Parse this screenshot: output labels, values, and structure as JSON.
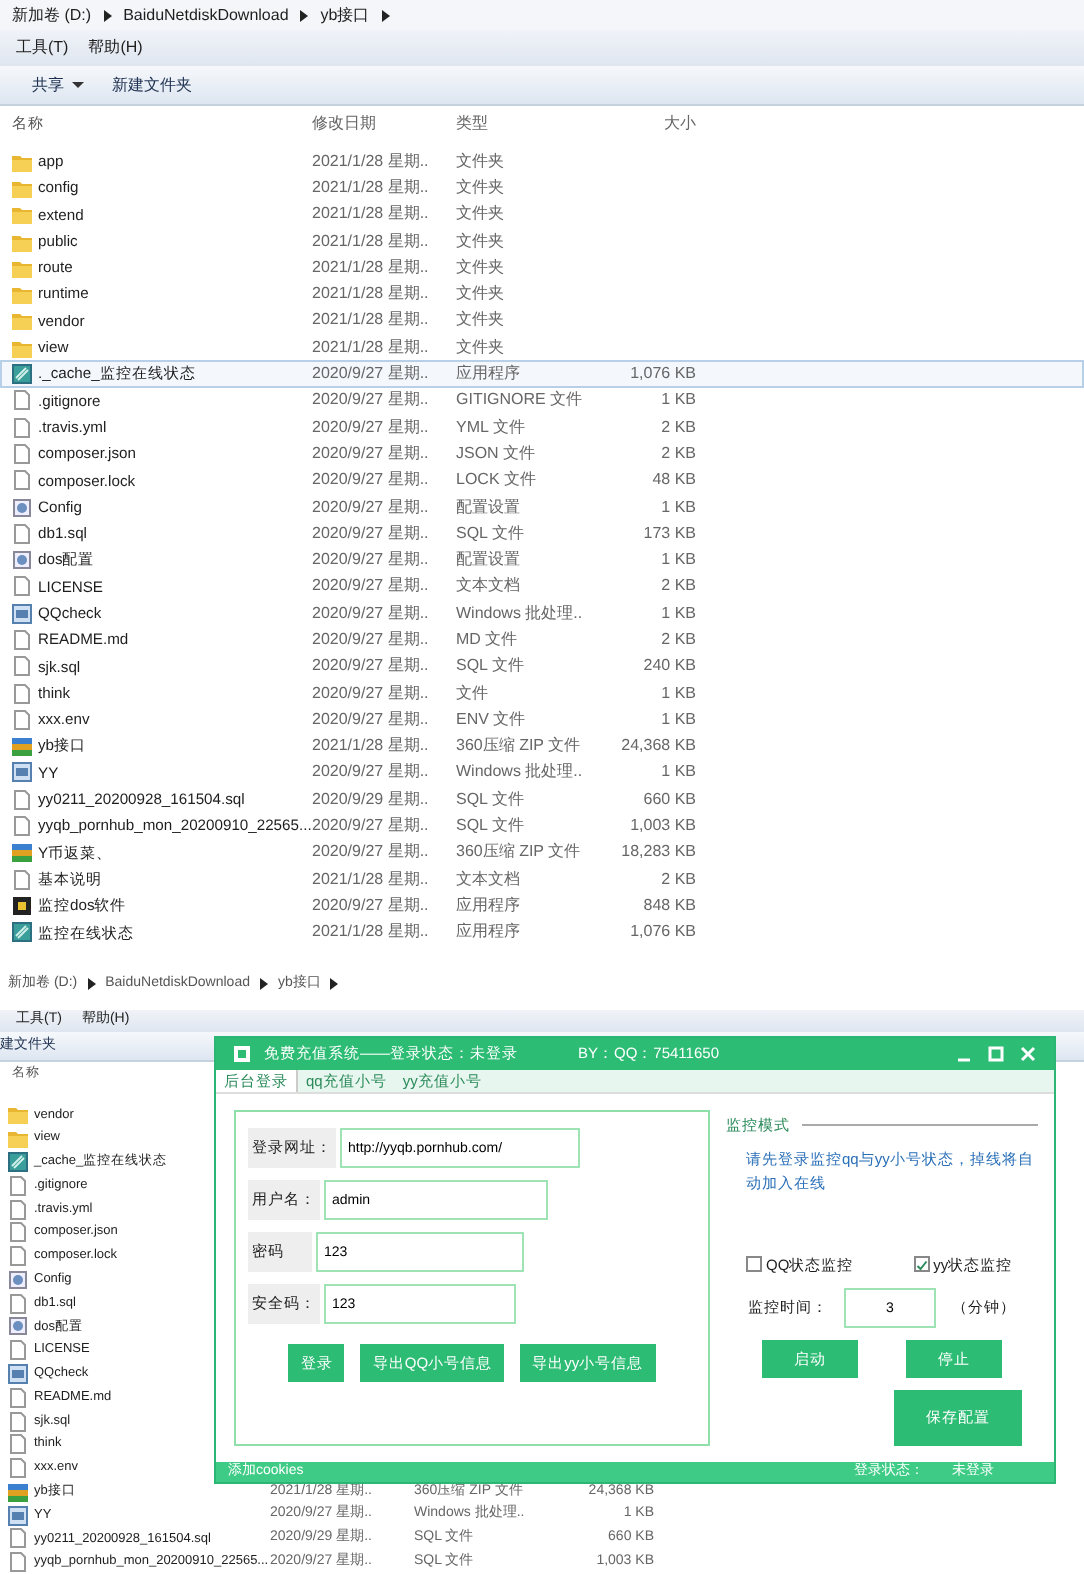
{
  "explorer": {
    "breadcrumb": [
      "新加卷 (D:)",
      "BaiduNetdiskDownload",
      "yb接口"
    ],
    "menu": [
      "工具(T)",
      "帮助(H)"
    ],
    "toolbar": [
      {
        "label": "共享",
        "kind": "dropdown"
      },
      {
        "label": "新建文件夹",
        "kind": "plain"
      }
    ],
    "columns": [
      "名称",
      "修改日期",
      "类型",
      "大小"
    ],
    "files": [
      {
        "name": "app",
        "date": "2021/1/28 星期..",
        "type": "文件夹",
        "kind": "folder",
        "selected": false
      },
      {
        "name": "config",
        "date": "2021/1/28 星期..",
        "type": "文件夹",
        "kind": "folder",
        "selected": false
      },
      {
        "name": "extend",
        "date": "2021/1/28 星期..",
        "type": "文件夹",
        "kind": "folder",
        "selected": false
      },
      {
        "name": "public",
        "date": "2021/1/28 星期..",
        "type": "文件夹",
        "kind": "folder",
        "selected": false
      },
      {
        "name": "route",
        "date": "2021/1/28 星期..",
        "type": "文件夹",
        "kind": "folder",
        "selected": false
      },
      {
        "name": "runtime",
        "date": "2021/1/28 星期..",
        "type": "文件夹",
        "kind": "folder",
        "selected": false
      },
      {
        "name": "vendor",
        "date": "2021/1/28 星期..",
        "type": "文件夹",
        "kind": "folder",
        "selected": false
      },
      {
        "name": "view",
        "date": "2021/1/28 星期..",
        "type": "文件夹",
        "kind": "folder",
        "selected": false
      },
      {
        "name": "._cache_监控在线状态",
        "date": "2020/9/27 星期..",
        "type": "应用程序",
        "size": "1,076 KB",
        "kind": "app",
        "selected": true
      },
      {
        "name": ".gitignore",
        "date": "2020/9/27 星期..",
        "type": "GITIGNORE 文件",
        "size": "1 KB",
        "kind": "file",
        "selected": false
      },
      {
        "name": ".travis.yml",
        "date": "2020/9/27 星期..",
        "type": "YML 文件",
        "size": "2 KB",
        "kind": "file",
        "selected": false
      },
      {
        "name": "composer.json",
        "date": "2020/9/27 星期..",
        "type": "JSON 文件",
        "size": "2 KB",
        "kind": "file",
        "selected": false
      },
      {
        "name": "composer.lock",
        "date": "2020/9/27 星期..",
        "type": "LOCK 文件",
        "size": "48 KB",
        "kind": "file",
        "selected": false
      },
      {
        "name": "Config",
        "date": "2020/9/27 星期..",
        "type": "配置设置",
        "size": "1 KB",
        "kind": "config",
        "selected": false
      },
      {
        "name": "db1.sql",
        "date": "2020/9/27 星期..",
        "type": "SQL 文件",
        "size": "173 KB",
        "kind": "file",
        "selected": false
      },
      {
        "name": "dos配置",
        "date": "2020/9/27 星期..",
        "type": "配置设置",
        "size": "1 KB",
        "kind": "config",
        "selected": false
      },
      {
        "name": "LICENSE",
        "date": "2020/9/27 星期..",
        "type": "文本文档",
        "size": "2 KB",
        "kind": "file",
        "selected": false
      },
      {
        "name": "QQcheck",
        "date": "2020/9/27 星期..",
        "type": "Windows 批处理..",
        "size": "1 KB",
        "kind": "batch",
        "selected": false
      },
      {
        "name": "README.md",
        "date": "2020/9/27 星期..",
        "type": "MD 文件",
        "size": "2 KB",
        "kind": "file",
        "selected": false
      },
      {
        "name": "sjk.sql",
        "date": "2020/9/27 星期..",
        "type": "SQL 文件",
        "size": "240 KB",
        "kind": "file",
        "selected": false
      },
      {
        "name": "think",
        "date": "2020/9/27 星期..",
        "type": "文件",
        "size": "1 KB",
        "kind": "file",
        "selected": false
      },
      {
        "name": "xxx.env",
        "date": "2020/9/27 星期..",
        "type": "ENV 文件",
        "size": "1 KB",
        "kind": "file",
        "selected": false
      },
      {
        "name": "yb接口",
        "date": "2021/1/28 星期..",
        "type": "360压缩 ZIP 文件",
        "size": "24,368 KB",
        "kind": "zip",
        "selected": false
      },
      {
        "name": "YY",
        "date": "2020/9/27 星期..",
        "type": "Windows 批处理..",
        "size": "1 KB",
        "kind": "batch",
        "selected": false
      },
      {
        "name": "yy0211_20200928_161504.sql",
        "date": "2020/9/29 星期..",
        "type": "SQL 文件",
        "size": "660 KB",
        "kind": "file",
        "selected": false
      },
      {
        "name": "yyqb_pornhub_mon_20200910_22565...",
        "date": "2020/9/27 星期..",
        "type": "SQL 文件",
        "size": "1,003 KB",
        "kind": "file",
        "selected": false
      },
      {
        "name": "Y币返菜、",
        "date": "2020/9/27 星期..",
        "type": "360压缩 ZIP 文件",
        "size": "18,283 KB",
        "kind": "zip",
        "selected": false
      },
      {
        "name": "基本说明",
        "date": "2021/1/28 星期..",
        "type": "文本文档",
        "size": "2 KB",
        "kind": "file",
        "selected": false
      },
      {
        "name": "监控dos软件",
        "date": "2020/9/27 星期..",
        "type": "应用程序",
        "size": "848 KB",
        "kind": "exe",
        "selected": false
      },
      {
        "name": "监控在线状态",
        "date": "2021/1/28 星期..",
        "type": "应用程序",
        "size": "1,076 KB",
        "kind": "app",
        "selected": false
      }
    ]
  },
  "explorer_behind": {
    "breadcrumb": [
      "新加卷 (D:)",
      "BaiduNetdiskDownload",
      "yb接口"
    ],
    "menu": [
      "工具(T)",
      "帮助(H)"
    ],
    "toolbar": [
      {
        "label": "建文件夹",
        "kind": "plain"
      }
    ],
    "columns": [
      "名称"
    ],
    "files": [
      {
        "name": "vendor",
        "kind": "folder"
      },
      {
        "name": "view",
        "kind": "folder"
      },
      {
        "name": "_cache_监控在线状态",
        "kind": "app"
      },
      {
        "name": ".gitignore",
        "kind": "file"
      },
      {
        "name": ".travis.yml",
        "kind": "file"
      },
      {
        "name": "composer.json",
        "kind": "file"
      },
      {
        "name": "composer.lock",
        "kind": "file"
      },
      {
        "name": "Config",
        "kind": "config"
      },
      {
        "name": "db1.sql",
        "kind": "file"
      },
      {
        "name": "dos配置",
        "kind": "config"
      },
      {
        "name": "LICENSE",
        "kind": "file"
      },
      {
        "name": "QQcheck",
        "kind": "batch"
      },
      {
        "name": "README.md",
        "kind": "file"
      },
      {
        "name": "sjk.sql",
        "kind": "file"
      },
      {
        "name": "think",
        "kind": "file"
      },
      {
        "name": "xxx.env",
        "kind": "file"
      },
      {
        "name": "yb接口",
        "date": "2021/1/28 星期..",
        "type": "360压缩 ZIP 文件",
        "size": "24,368 KB",
        "kind": "zip"
      },
      {
        "name": "YY",
        "date": "2020/9/27 星期..",
        "type": "Windows 批处理..",
        "size": "1 KB",
        "kind": "batch"
      },
      {
        "name": "yy0211_20200928_161504.sql",
        "date": "2020/9/29 星期..",
        "type": "SQL 文件",
        "size": "660 KB",
        "kind": "file"
      },
      {
        "name": "yyqb_pornhub_mon_20200910_22565...",
        "date": "2020/9/27 星期..",
        "type": "SQL 文件",
        "size": "1,003 KB",
        "kind": "file"
      }
    ]
  },
  "app_window": {
    "title": "免费充值系统——登录状态：未登录",
    "author": "BY：QQ：75411650",
    "tabs": [
      {
        "label": "后台登录",
        "selected": true
      },
      {
        "label": "qq充值小号",
        "selected": false
      },
      {
        "label": "yy充值小号",
        "selected": false
      }
    ],
    "fields": [
      {
        "label": "登录网址：",
        "value": "http://yyqb.pornhub.com/"
      },
      {
        "label": "用户名：",
        "value": "admin"
      },
      {
        "label": "密码",
        "value": "123"
      },
      {
        "label": "安全码：",
        "value": "123"
      }
    ],
    "buttons": [
      "登录",
      "导出QQ小号信息",
      "导出yy小号信息"
    ],
    "monitor": {
      "title": "监控模式",
      "description": "请先登录监控qq与yy小号状态，掉线将自动加入在线",
      "checkboxes": [
        {
          "label": "QQ状态监控",
          "checked": false
        },
        {
          "label": "yy状态监控",
          "checked": true
        }
      ],
      "interval_label": "监控时间：",
      "interval": "3",
      "interval_unit": "（分钟）",
      "buttons": [
        "启动",
        "停止"
      ],
      "save": "保存配置"
    },
    "status_bar": {
      "left": "添加cookies",
      "label": "登录状态：",
      "value": "未登录"
    }
  }
}
